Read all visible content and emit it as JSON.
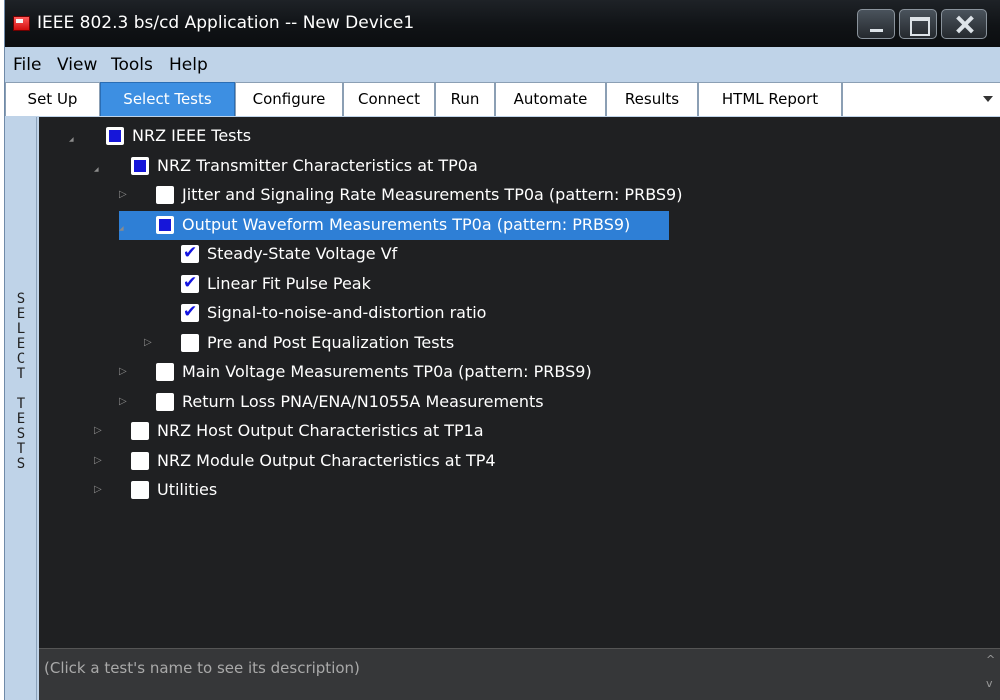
{
  "window": {
    "title": "IEEE 802.3 bs/cd Application -- New Device1"
  },
  "menu": [
    {
      "label": "File"
    },
    {
      "label": "View"
    },
    {
      "label": "Tools"
    },
    {
      "label": "Help"
    }
  ],
  "tabs": [
    {
      "label": "Set Up",
      "active": false
    },
    {
      "label": "Select Tests",
      "active": true
    },
    {
      "label": "Configure",
      "active": false
    },
    {
      "label": "Connect",
      "active": false
    },
    {
      "label": "Run",
      "active": false
    },
    {
      "label": "Automate",
      "active": false
    },
    {
      "label": "Results",
      "active": false
    },
    {
      "label": "HTML Report",
      "active": false
    }
  ],
  "side_label": "SELECT TESTS",
  "tree": [
    {
      "label": "NRZ IEEE Tests",
      "state": "partial",
      "expanded": true,
      "level": 0
    },
    {
      "label": "NRZ Transmitter Characteristics at TP0a",
      "state": "partial",
      "expanded": true,
      "level": 1
    },
    {
      "label": "Jitter and Signaling Rate Measurements TP0a (pattern: PRBS9)",
      "state": "unchecked",
      "expanded": false,
      "level": 2
    },
    {
      "label": "Output Waveform Measurements TP0a (pattern: PRBS9)",
      "state": "partial",
      "expanded": true,
      "level": 2,
      "selected": true
    },
    {
      "label": "Steady-State Voltage Vf",
      "state": "checked",
      "leaf": true,
      "level": 3
    },
    {
      "label": "Linear Fit Pulse Peak",
      "state": "checked",
      "leaf": true,
      "level": 3
    },
    {
      "label": "Signal-to-noise-and-distortion ratio",
      "state": "checked",
      "leaf": true,
      "level": 3
    },
    {
      "label": "Pre and Post Equalization Tests",
      "state": "unchecked",
      "expanded": false,
      "level": 3
    },
    {
      "label": "Main Voltage Measurements TP0a (pattern: PRBS9)",
      "state": "unchecked",
      "expanded": false,
      "level": 2
    },
    {
      "label": "Return Loss PNA/ENA/N1055A Measurements",
      "state": "unchecked",
      "expanded": false,
      "level": 2
    },
    {
      "label": "NRZ Host Output Characteristics at TP1a",
      "state": "unchecked",
      "expanded": false,
      "level": 1
    },
    {
      "label": "NRZ Module Output Characteristics at TP4",
      "state": "unchecked",
      "expanded": false,
      "level": 1
    },
    {
      "label": "Utilities",
      "state": "unchecked",
      "expanded": false,
      "level": 1
    }
  ],
  "description_placeholder": "(Click a test's name to see its description)",
  "colors": {
    "tree_background": "#1f2022",
    "selection": "#2e7fd6",
    "active_tab": "#3d8fe2",
    "chrome": "#bfd3e8"
  }
}
